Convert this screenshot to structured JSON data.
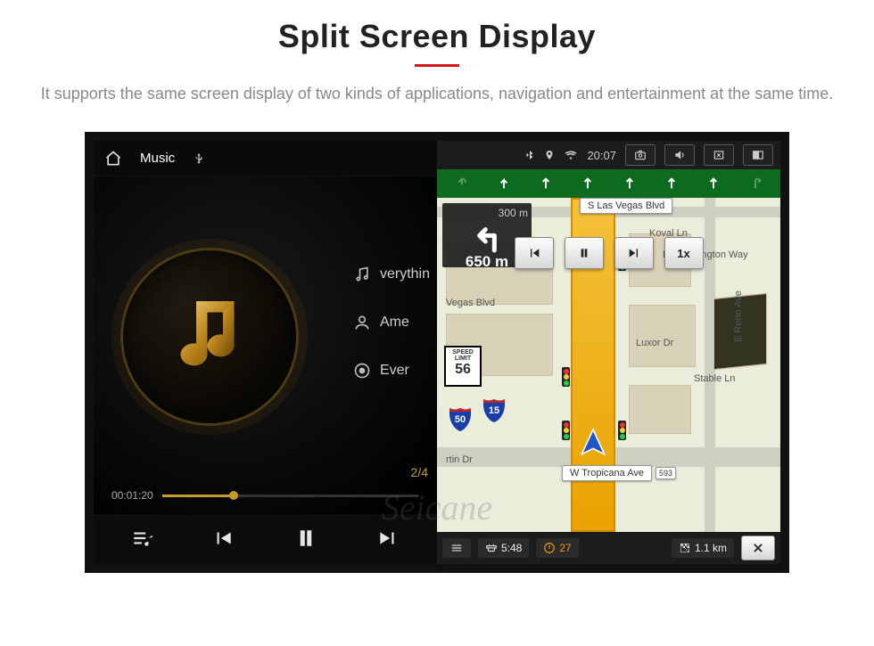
{
  "page": {
    "title": "Split Screen Display",
    "description": "It supports the same screen display of two kinds of applications, navigation and entertainment at the same time."
  },
  "watermark": "Seicane",
  "music": {
    "topbar": {
      "title": "Music"
    },
    "track": {
      "title": "verythin",
      "artist": "Ame",
      "album": "Ever"
    },
    "counter": "2/4",
    "elapsed": "00:01:20",
    "progress_percent": 28
  },
  "status_bar": {
    "time": "20:07"
  },
  "nav": {
    "turn": {
      "small_distance": "300 m",
      "main_distance": "650 m"
    },
    "sim_speed": "1x",
    "speed_limit": {
      "label": "SPEED LIMIT",
      "value": "56"
    },
    "route_shields": [
      "15",
      "50"
    ],
    "streets": {
      "top": "S Las Vegas Blvd",
      "mid1": "Koval Ln",
      "mid2": "Duke Ellington Way",
      "left": "Vegas Blvd",
      "luxor": "Luxor Dr",
      "stable": "Stable Ln",
      "reno": "E Reno Ave",
      "martin": "rtin Dr",
      "bottom": "W Tropicana Ave",
      "bottom_num": "593"
    },
    "footer": {
      "eta": "5:48",
      "alert": "27",
      "remaining": "1.1 km"
    }
  }
}
